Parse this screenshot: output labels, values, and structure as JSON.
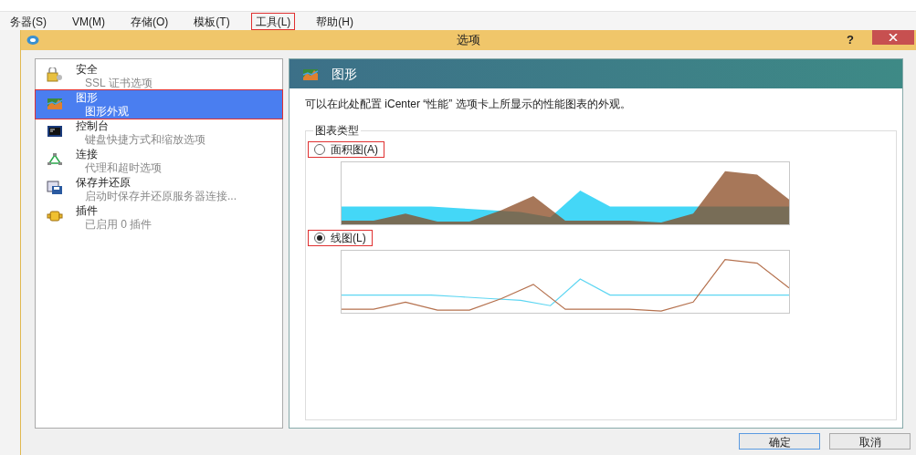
{
  "menu_bar": {
    "items": [
      {
        "label": "务器(S)",
        "annotated": false
      },
      {
        "label": "VM(M)",
        "annotated": false
      },
      {
        "label": "存储(O)",
        "annotated": false
      },
      {
        "label": "模板(T)",
        "annotated": false
      },
      {
        "label": "工具(L)",
        "annotated": true
      },
      {
        "label": "帮助(H)",
        "annotated": false
      }
    ]
  },
  "dialog": {
    "title": "选项",
    "help": "?",
    "sidebar": {
      "items": [
        {
          "kind": "security",
          "title": "安全",
          "subtitle": "SSL 证书选项",
          "selected": false,
          "annotated": false
        },
        {
          "kind": "graphics",
          "title": "图形",
          "subtitle": "图形外观",
          "selected": true,
          "annotated": true
        },
        {
          "kind": "console",
          "title": "控制台",
          "subtitle": "键盘快捷方式和缩放选项",
          "selected": false,
          "annotated": false
        },
        {
          "kind": "connection",
          "title": "连接",
          "subtitle": "代理和超时选项",
          "selected": false,
          "annotated": false
        },
        {
          "kind": "save",
          "title": "保存并还原",
          "subtitle": "启动时保存并还原服务器连接...",
          "selected": false,
          "annotated": false
        },
        {
          "kind": "plugin",
          "title": "插件",
          "subtitle": "已启用 0 插件",
          "selected": false,
          "annotated": false
        }
      ]
    },
    "panel": {
      "title": "图形",
      "description": "可以在此处配置 iCenter “性能” 选项卡上所显示的性能图表的外观。",
      "group_title": "图表类型",
      "options": [
        {
          "kind": "area",
          "label": "面积图(A)",
          "selected": false,
          "annotated": true
        },
        {
          "kind": "line",
          "label": "线图(L)",
          "selected": true,
          "annotated": true
        }
      ]
    },
    "buttons": [
      {
        "label": "确定",
        "default": true
      },
      {
        "label": "取消",
        "default": false
      }
    ]
  }
}
